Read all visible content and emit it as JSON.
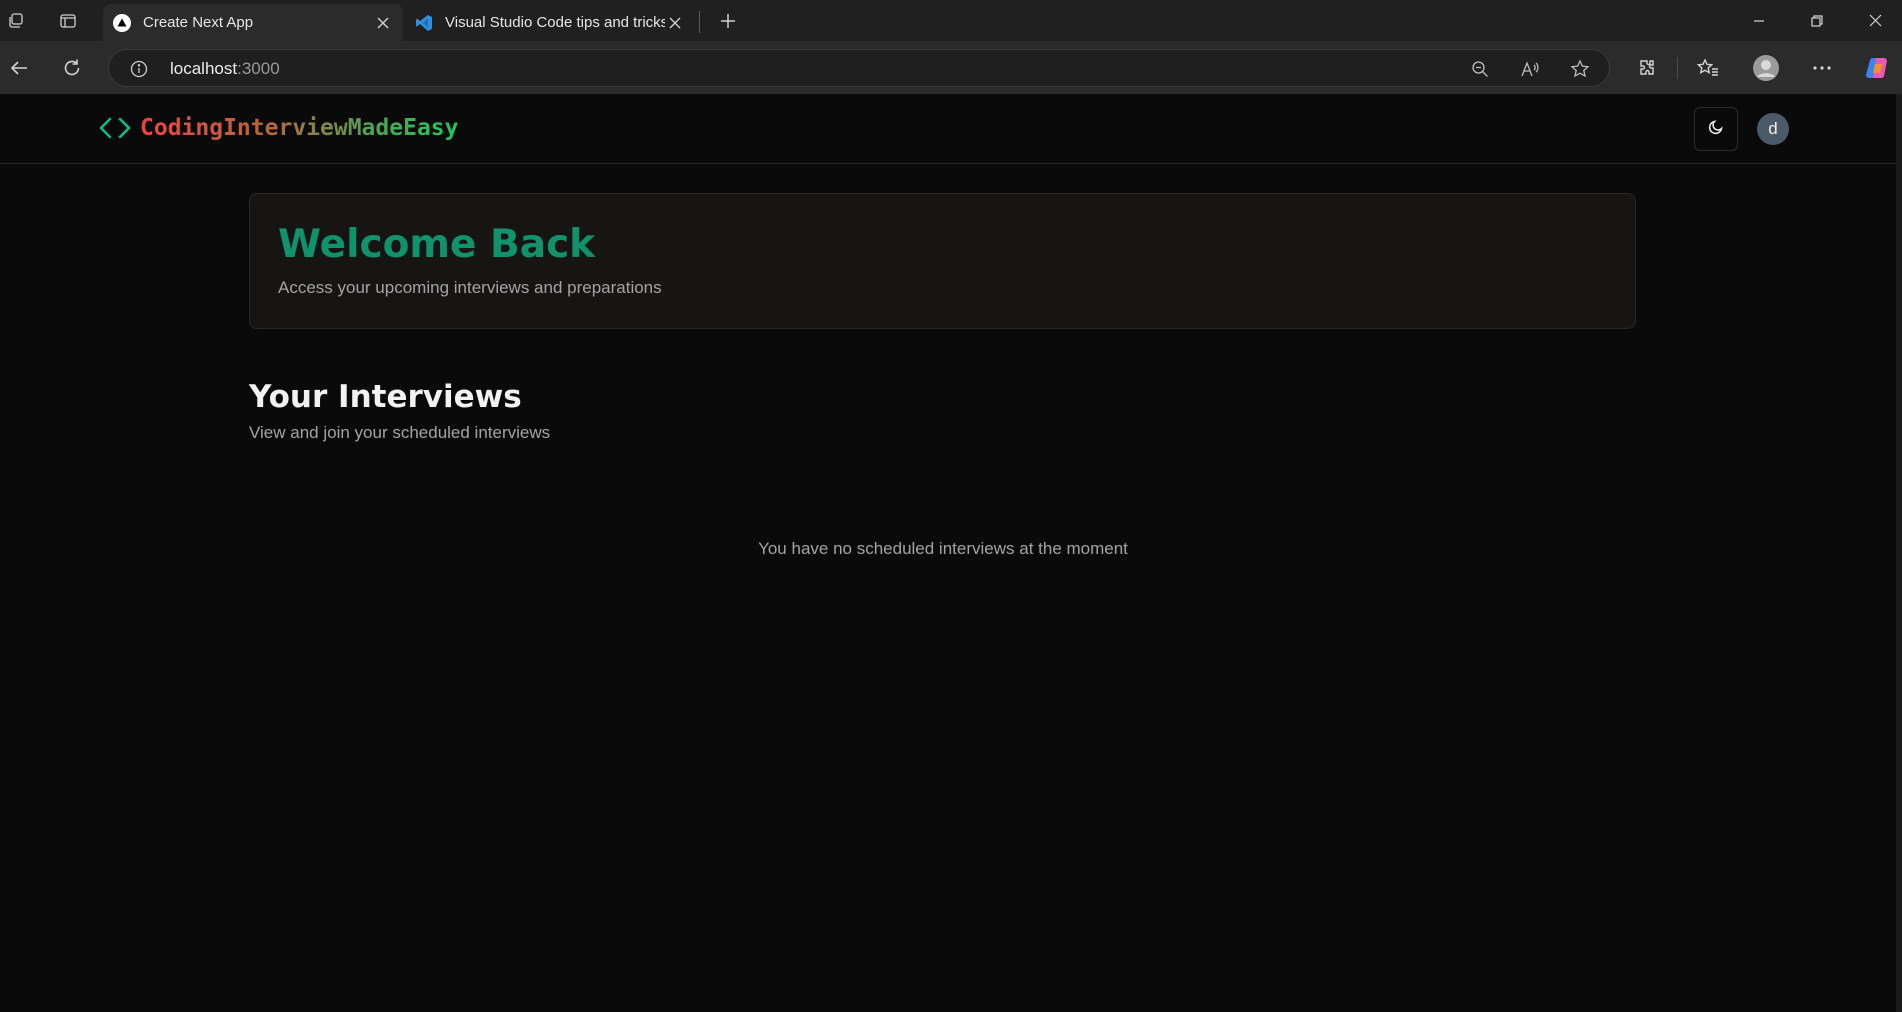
{
  "browser": {
    "tabs": [
      {
        "title": "Create Next App",
        "icon": "nextjs-triangle-icon",
        "active": true
      },
      {
        "title": "Visual Studio Code tips and tricks",
        "icon": "vscode-icon",
        "active": false
      }
    ],
    "address": {
      "host": "localhost",
      "port": ":3000"
    }
  },
  "header": {
    "brand": "CodingInterviewMadeEasy",
    "brand_icon": "code-brackets-icon",
    "theme_icon": "moon-icon",
    "avatar_initial": "d"
  },
  "welcome": {
    "title": "Welcome Back",
    "subtitle": "Access your upcoming interviews and preparations"
  },
  "interviews": {
    "title": "Your Interviews",
    "subtitle": "View and join your scheduled interviews",
    "empty_message": "You have no scheduled interviews at the moment"
  },
  "colors": {
    "accent": "#10936b",
    "background": "#0a0a0a",
    "card": "#171514"
  }
}
